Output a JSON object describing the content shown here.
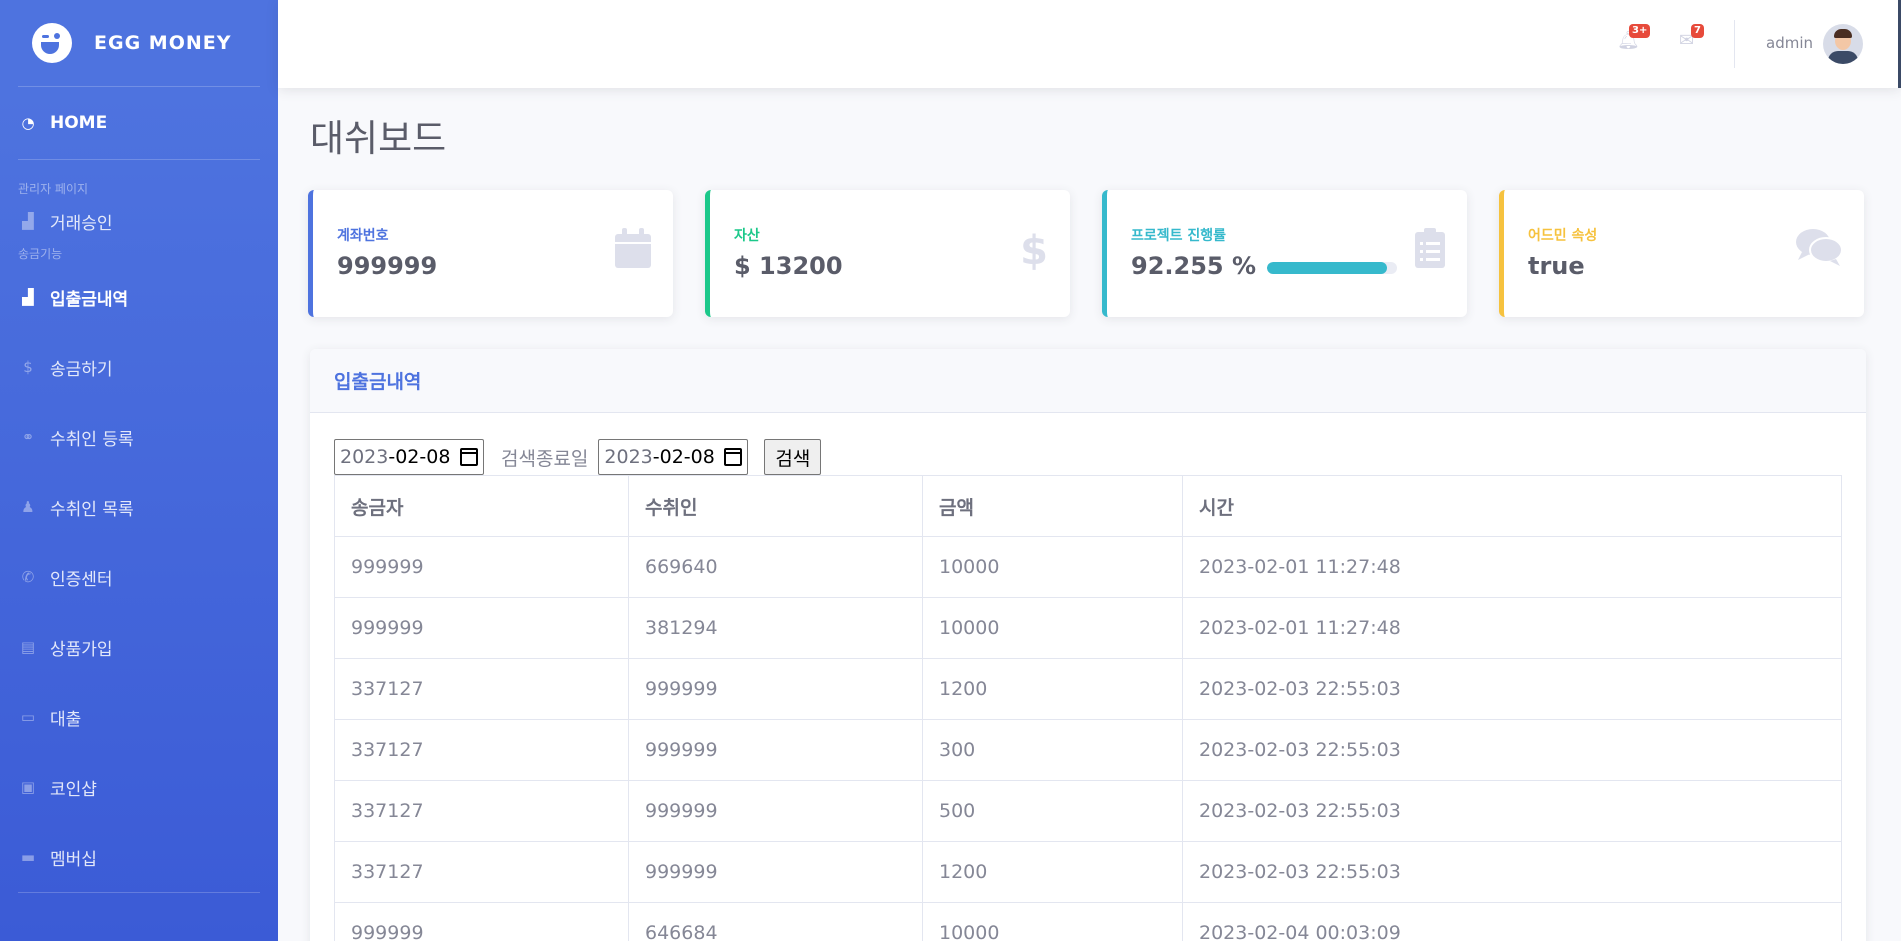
{
  "brand": {
    "name": "EGG MONEY"
  },
  "sidebar": {
    "home": "HOME",
    "section1": "관리자 페이지",
    "section2": "송금기능",
    "items": [
      {
        "label": "거래승인",
        "icon": "chart-area-icon"
      },
      {
        "label": "입출금내역",
        "icon": "chart-area-icon"
      },
      {
        "label": "송금하기",
        "icon": "dollar-icon"
      },
      {
        "label": "수취인 등록",
        "icon": "handshake-icon"
      },
      {
        "label": "수취인 목록",
        "icon": "person-icon"
      },
      {
        "label": "인증센터",
        "icon": "phone-icon"
      },
      {
        "label": "상품가입",
        "icon": "file-icon"
      },
      {
        "label": "대출",
        "icon": "money-bill-icon"
      },
      {
        "label": "코인샵",
        "icon": "id-card-icon"
      },
      {
        "label": "멤버십",
        "icon": "credit-card-icon"
      }
    ]
  },
  "topbar": {
    "alerts_badge": "3+",
    "messages_badge": "7",
    "user_name": "admin"
  },
  "page": {
    "title": "대쉬보드"
  },
  "cards": [
    {
      "label": "계좌번호",
      "value": "999999",
      "color": "#4e73df",
      "icon": "calendar-icon"
    },
    {
      "label": "자산",
      "value": "$ 13200",
      "color": "#1cc88a",
      "icon": "dollar-icon"
    },
    {
      "label": "프로젝트 진행률",
      "value": "92.255 %",
      "color": "#36b9cc",
      "icon": "clipboard-list-icon",
      "progress": 92.255
    },
    {
      "label": "어드민 속성",
      "value": "true",
      "color": "#f6c23e",
      "icon": "comments-icon"
    }
  ],
  "panel": {
    "title": "입출금내역",
    "start_date_year": "2023",
    "start_date_rest": "-02-08",
    "end_label": "검색종료일",
    "end_date_year": "2023",
    "end_date_rest": "-02-08",
    "search_button": "검색",
    "columns": [
      "송금자",
      "수취인",
      "금액",
      "시간"
    ],
    "rows": [
      [
        "999999",
        "669640",
        "10000",
        "2023-02-01 11:27:48"
      ],
      [
        "999999",
        "381294",
        "10000",
        "2023-02-01 11:27:48"
      ],
      [
        "337127",
        "999999",
        "1200",
        "2023-02-03 22:55:03"
      ],
      [
        "337127",
        "999999",
        "300",
        "2023-02-03 22:55:03"
      ],
      [
        "337127",
        "999999",
        "500",
        "2023-02-03 22:55:03"
      ],
      [
        "337127",
        "999999",
        "1200",
        "2023-02-03 22:55:03"
      ],
      [
        "999999",
        "646684",
        "10000",
        "2023-02-04 00:03:09"
      ]
    ]
  }
}
